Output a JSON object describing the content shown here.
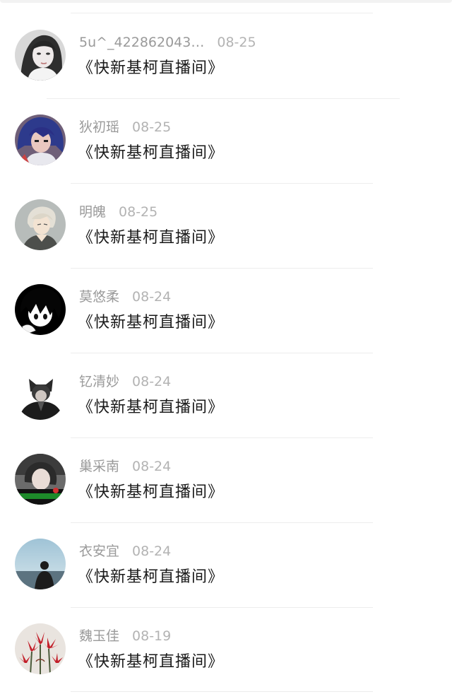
{
  "comments": [
    {
      "username": "5u^_422862043…",
      "time": "08-25",
      "text": "《快新基柯直播间》",
      "avatar_icon": "avatar-girl-grayscale-icon"
    },
    {
      "username": "狄初瑶",
      "time": "08-25",
      "text": "《快新基柯直播间》",
      "avatar_icon": "avatar-blue-hair-icon"
    },
    {
      "username": "明魄",
      "time": "08-25",
      "text": "《快新基柯直播间》",
      "avatar_icon": "avatar-anime-silver-hair-icon"
    },
    {
      "username": "莫悠柔",
      "time": "08-24",
      "text": "《快新基柯直播间》",
      "avatar_icon": "avatar-anime-black-hair-icon"
    },
    {
      "username": "钇清妙",
      "time": "08-24",
      "text": "《快新基柯直播间》",
      "avatar_icon": "avatar-cat-ears-icon"
    },
    {
      "username": "巢采南",
      "time": "08-24",
      "text": "《快新基柯直播间》",
      "avatar_icon": "avatar-portrait-green-banner-icon"
    },
    {
      "username": "衣安宜",
      "time": "08-24",
      "text": "《快新基柯直播间》",
      "avatar_icon": "avatar-silhouette-sea-icon"
    },
    {
      "username": "魏玉佳",
      "time": "08-19",
      "text": "《快新基柯直播间》",
      "avatar_icon": "avatar-red-flowers-icon"
    }
  ],
  "colors": {
    "username": "#9a9a9a",
    "time": "#b3b3b3",
    "text": "#1a1a1a",
    "divider": "#ededed"
  }
}
